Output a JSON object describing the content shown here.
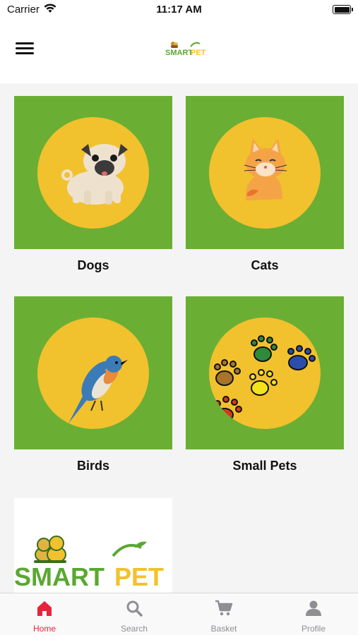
{
  "status_bar": {
    "carrier": "Carrier",
    "time": "11:17 AM"
  },
  "header": {
    "logo_text_1": "SMART",
    "logo_text_2": "PET",
    "logo_alt": "Smart Pet logo"
  },
  "categories": [
    {
      "label": "Dogs",
      "icon": "pug-dog-icon"
    },
    {
      "label": "Cats",
      "icon": "cat-icon"
    },
    {
      "label": "Birds",
      "icon": "bluebird-icon"
    },
    {
      "label": "Small Pets",
      "icon": "paw-prints-icon"
    }
  ],
  "promo": {
    "text_1": "SMART",
    "text_2": "PET"
  },
  "tab_bar": {
    "items": [
      {
        "label": "Home",
        "icon": "home-icon",
        "active": true
      },
      {
        "label": "Search",
        "icon": "search-icon",
        "active": false
      },
      {
        "label": "Basket",
        "icon": "cart-icon",
        "active": false
      },
      {
        "label": "Profile",
        "icon": "person-icon",
        "active": false
      }
    ]
  },
  "colors": {
    "tile_green": "#6aaf33",
    "tile_circle": "#f2c12e",
    "active_tab": "#e8243c",
    "inactive_tab": "#8e8e93",
    "logo_green": "#5aa832",
    "logo_yellow": "#f2c12e"
  }
}
